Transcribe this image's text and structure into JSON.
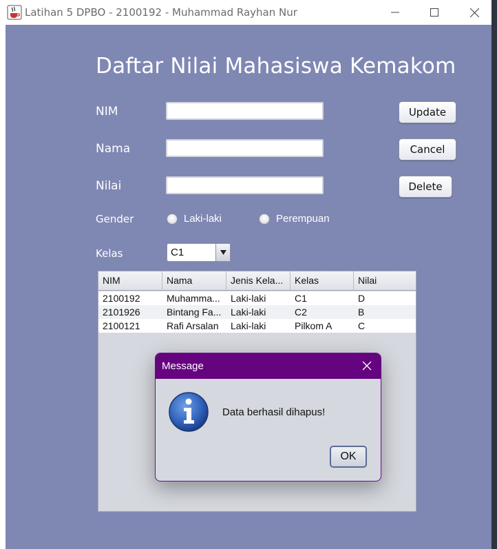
{
  "window": {
    "title": "Latihan 5 DPBO - 2100192 - Muhammad Rayhan Nur",
    "app_icon": "java-cup-icon",
    "controls": [
      "minimize-icon",
      "maximize-icon",
      "close-icon"
    ]
  },
  "form": {
    "heading": "Daftar Nilai Mahasiswa Kemakom",
    "nim_label": "NIM",
    "nama_label": "Nama",
    "nilai_label": "Nilai",
    "nim_value": "",
    "nama_value": "",
    "nilai_value": "",
    "gender_label": "Gender",
    "gender_options": [
      "Laki-laki",
      "Perempuan"
    ],
    "kelas_label": "Kelas",
    "kelas_selected": "C1",
    "buttons": {
      "update": "Update",
      "cancel": "Cancel",
      "delete": "Delete"
    }
  },
  "table": {
    "columns": [
      "NIM",
      "Nama",
      "Jenis Kela...",
      "Kelas",
      "Nilai"
    ],
    "rows": [
      [
        "2100192",
        "Muhamma...",
        "Laki-laki",
        "C1",
        "D"
      ],
      [
        "2101926",
        "Bintang Fa...",
        "Laki-laki",
        "C2",
        "B"
      ],
      [
        "2100121",
        "Rafi Arsalan",
        "Laki-laki",
        "Pilkom A",
        "C"
      ]
    ]
  },
  "dialog": {
    "title": "Message",
    "icon": "info-icon",
    "message": "Data berhasil dihapus!",
    "ok_label": "OK"
  },
  "colors": {
    "content_bg": "#7f87b3",
    "dialog_title_bg": "#66037f",
    "table_bg": "#d5d8de"
  }
}
